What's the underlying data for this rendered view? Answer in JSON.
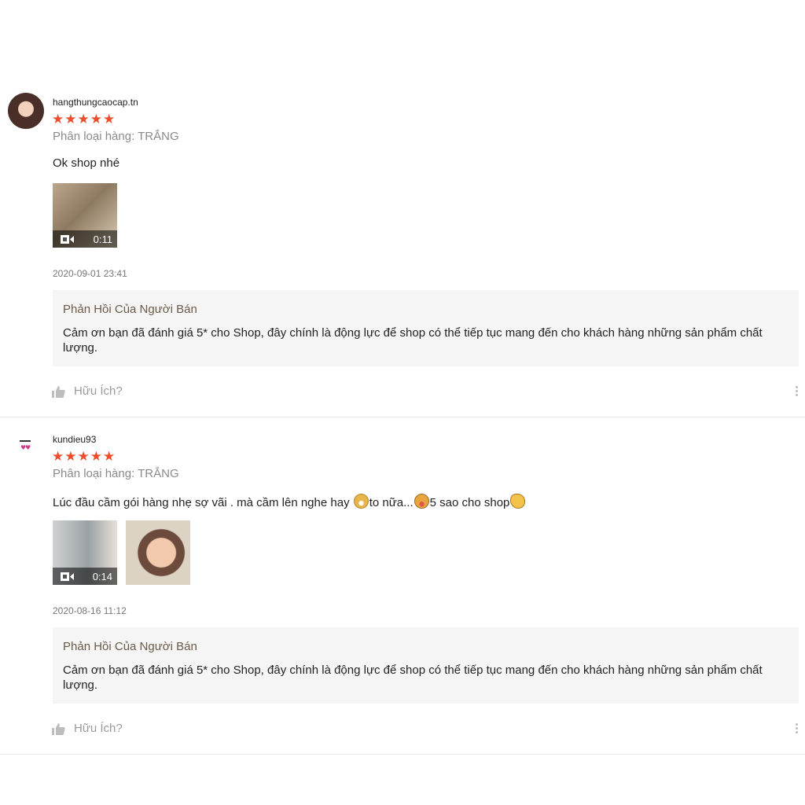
{
  "reviews": [
    {
      "username": "hangthungcaocap.tn",
      "rating_stars": 5,
      "stars_text": "★★★★★",
      "variation": "Phân loại hàng: TRẮNG",
      "comment": "Ok shop nhé",
      "media": [
        {
          "type": "video",
          "duration": "0:11"
        }
      ],
      "timestamp": "2020-09-01 23:41",
      "seller_reply": {
        "title": "Phản Hồi Của Người Bán",
        "text": "Cảm ơn bạn đã đánh giá 5* cho Shop, đây chính là động lực để shop có thể tiếp tục mang đến cho khách hàng những sản phẩm chất lượng."
      },
      "helpful_label": "Hữu Ích?"
    },
    {
      "username": "kundieu93",
      "rating_stars": 5,
      "stars_text": "★★★★★",
      "variation": "Phân loại hàng: TRẮNG",
      "comment_parts": [
        "Lúc đầu cầm gói hàng nhẹ sợ vãi . mà cầm lên nghe hay ",
        "to nữa...",
        "5 sao cho shop"
      ],
      "media": [
        {
          "type": "video",
          "duration": "0:14"
        },
        {
          "type": "image"
        }
      ],
      "timestamp": "2020-08-16 11:12",
      "seller_reply": {
        "title": "Phản Hồi Của Người Bán",
        "text": "Cảm ơn bạn đã đánh giá 5* cho Shop, đây chính là động lực để shop có thể tiếp tục mang đến cho khách hàng những sản phẩm chất lượng."
      },
      "helpful_label": "Hữu Ích?"
    }
  ],
  "colors": {
    "star": "#ee4d2d",
    "reply_bg": "#f5f5f5",
    "reply_title": "#6b5a48",
    "muted": "#8a8a8a"
  },
  "icons": [
    "video-camera-icon",
    "thumbs-up-icon",
    "more-options-icon",
    "grin-emoji-icon",
    "tongue-emoji-icon",
    "clap-emoji-icon"
  ]
}
